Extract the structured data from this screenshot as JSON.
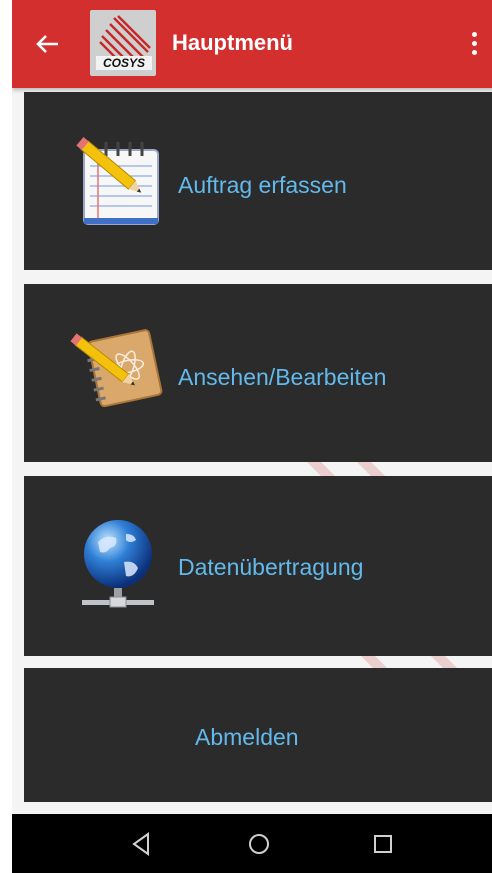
{
  "appbar": {
    "title": "Hauptmenü",
    "back_icon": "arrow-left-icon",
    "overflow_icon": "more-vert-icon",
    "color": "#d32f2f",
    "logo_text": "COSYS"
  },
  "menu": {
    "items": [
      {
        "label": "Auftrag erfassen",
        "icon": "notepad-pencil-icon"
      },
      {
        "label": "Ansehen/Bearbeiten",
        "icon": "notebook-pencil-icon"
      },
      {
        "label": "Datenübertragung",
        "icon": "globe-network-icon"
      },
      {
        "label": "Abmelden",
        "icon": ""
      }
    ],
    "tile_color": "#2b2b2b",
    "label_color": "#62b9ec"
  },
  "navbar": {
    "buttons": [
      "back-triangle-icon",
      "home-circle-icon",
      "recents-square-icon"
    ]
  }
}
